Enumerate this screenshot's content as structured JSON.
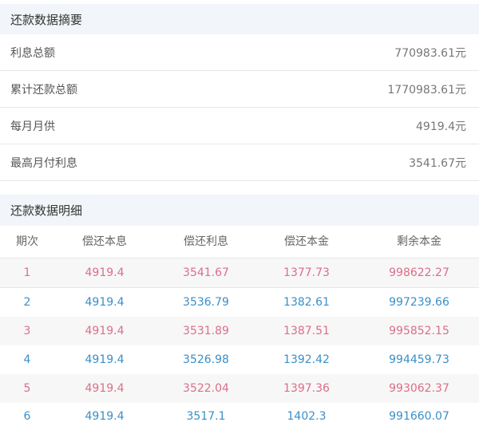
{
  "summary": {
    "title": "还款数据摘要",
    "rows": [
      {
        "label": "利息总额",
        "value": "770983.61元"
      },
      {
        "label": "累计还款总额",
        "value": "1770983.61元"
      },
      {
        "label": "每月月供",
        "value": "4919.4元"
      },
      {
        "label": "最高月付利息",
        "value": "3541.67元"
      }
    ]
  },
  "detail": {
    "title": "还款数据明细",
    "columns": [
      "期次",
      "偿还本息",
      "偿还利息",
      "偿还本金",
      "剩余本金"
    ],
    "rows": [
      [
        "1",
        "4919.4",
        "3541.67",
        "1377.73",
        "998622.27"
      ],
      [
        "2",
        "4919.4",
        "3536.79",
        "1382.61",
        "997239.66"
      ],
      [
        "3",
        "4919.4",
        "3531.89",
        "1387.51",
        "995852.15"
      ],
      [
        "4",
        "4919.4",
        "3526.98",
        "1392.42",
        "994459.73"
      ],
      [
        "5",
        "4919.4",
        "3522.04",
        "1397.36",
        "993062.37"
      ],
      [
        "6",
        "4919.4",
        "3517.1",
        "1402.3",
        "991660.07"
      ]
    ]
  },
  "colors": {
    "odd_row_text": "#d9708a",
    "even_row_text": "#3a8fc8",
    "header_bg": "#f2f5f9"
  }
}
